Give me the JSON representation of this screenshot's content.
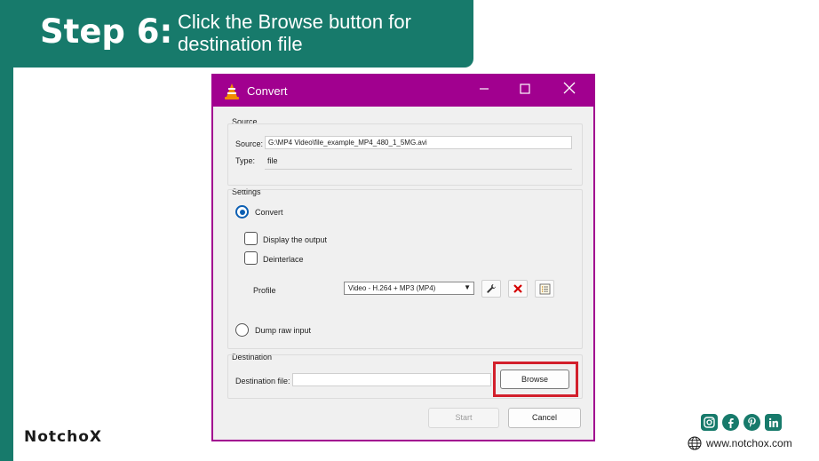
{
  "banner": {
    "step": "Step 6:",
    "description": "Click the Browse button for destination file"
  },
  "dialog": {
    "title": "Convert",
    "source_group": {
      "title": "Source",
      "source_label": "Source:",
      "source_value": "G:\\MP4 Video\\file_example_MP4_480_1_5MG.avi",
      "type_label": "Type:",
      "type_value": "file"
    },
    "settings_group": {
      "title": "Settings",
      "convert_label": "Convert",
      "display_output_label": "Display the output",
      "deinterlace_label": "Deinterlace",
      "profile_label": "Profile",
      "profile_value": "Video - H.264 + MP3 (MP4)",
      "dump_raw_label": "Dump raw input"
    },
    "destination_group": {
      "title": "Destination",
      "dest_file_label": "Destination file:",
      "dest_file_value": "",
      "browse_label": "Browse"
    },
    "start_label": "Start",
    "cancel_label": "Cancel"
  },
  "footer": {
    "brand": "NotchoX",
    "website": "www.notchox.com",
    "socials": [
      "instagram-icon",
      "facebook-icon",
      "pinterest-icon",
      "linkedin-icon"
    ]
  },
  "colors": {
    "brand_teal": "#177a6b",
    "titlebar_magenta": "#a1008f",
    "highlight_red": "#d21f2b",
    "radio_blue": "#0c5fb3"
  }
}
